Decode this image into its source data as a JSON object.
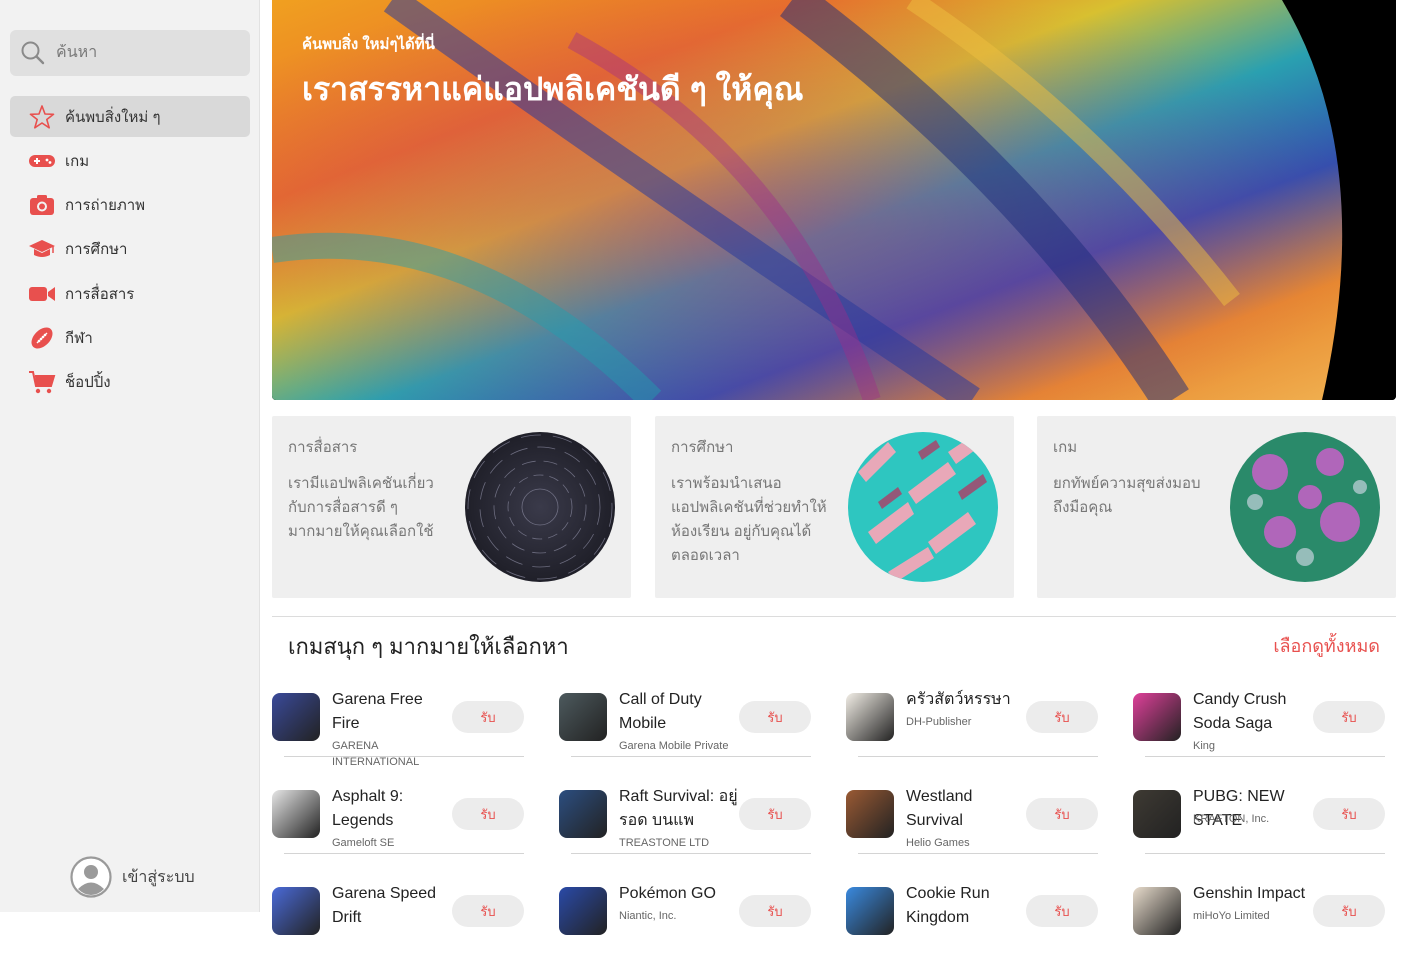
{
  "search": {
    "placeholder": "ค้นหา"
  },
  "sidebar": {
    "items": [
      {
        "label": "ค้นพบสิ่งใหม่ ๆ",
        "icon": "star-icon"
      },
      {
        "label": "เกม",
        "icon": "gamepad-icon"
      },
      {
        "label": "การถ่ายภาพ",
        "icon": "camera-icon"
      },
      {
        "label": "การศึกษา",
        "icon": "graduation-cap-icon"
      },
      {
        "label": "การสื่อสาร",
        "icon": "video-camera-icon"
      },
      {
        "label": "กีฬา",
        "icon": "football-icon"
      },
      {
        "label": "ช็อปปิ้ง",
        "icon": "shopping-cart-icon"
      }
    ],
    "login_label": "เข้าสู่ระบบ"
  },
  "hero": {
    "kicker": "ค้นพบสิ่ง ใหม่ๆได้ที่นี่",
    "title": "เราสรรหาแค่แอปพลิเคชันดี ๆ ให้คุณ"
  },
  "cards": [
    {
      "title": "การสื่อสาร",
      "desc": "เรามีแอปพลิเคชันเกี่ยวกับการสื่อสารดี ๆ มากมายให้คุณเลือกใช้"
    },
    {
      "title": "การศึกษา",
      "desc": "เราพร้อมนำเสนอแอปพลิเคชันที่ช่วยทำให้ห้องเรียน อยู่กับคุณได้ตลอดเวลา"
    },
    {
      "title": "เกม",
      "desc": "ยกทัพย์ความสุขส่งมอบถึงมือคุณ"
    }
  ],
  "games_section": {
    "title": "เกมสนุก ๆ มากมายให้เลือกหา",
    "see_all": "เลือกดูทั้งหมด",
    "get_label": "รับ",
    "apps": [
      {
        "name": "Garena Free Fire",
        "publisher": "GARENA INTERNATIONAL",
        "color": "#3a4a9a"
      },
      {
        "name": "Call of Duty Mobile",
        "publisher": "Garena Mobile Private",
        "color": "#4d5a5e"
      },
      {
        "name": "ครัวสัตว์หรรษา",
        "publisher": "DH-Publisher",
        "color": "#f2eee6"
      },
      {
        "name": "Candy Crush Soda Saga",
        "publisher": "King",
        "color": "#e0409a"
      },
      {
        "name": "Asphalt 9: Legends",
        "publisher": "Gameloft SE",
        "color": "#e6e6e6"
      },
      {
        "name": "Raft Survival: อยู่รอด บนแพ",
        "publisher": "TREASTONE LTD",
        "color": "#2c4e80"
      },
      {
        "name": "Westland Survival",
        "publisher": "Helio Games",
        "color": "#9a5a34"
      },
      {
        "name": "PUBG: NEW STATE",
        "publisher": "KRAFTON, Inc.",
        "color": "#3e3a33"
      },
      {
        "name": "Garena Speed Drift",
        "publisher": "",
        "color": "#4a6ad8"
      },
      {
        "name": "Pokémon GO",
        "publisher": "Niantic, Inc.",
        "color": "#2a4aa8"
      },
      {
        "name": "Cookie Run Kingdom",
        "publisher": "",
        "color": "#3a8ae0"
      },
      {
        "name": "Genshin Impact",
        "publisher": "miHoYo Limited",
        "color": "#e8dccc"
      }
    ]
  },
  "colors": {
    "accent": "#e8504e",
    "sidebar_bg": "#f2f2f2",
    "card_bg": "#efefef"
  }
}
